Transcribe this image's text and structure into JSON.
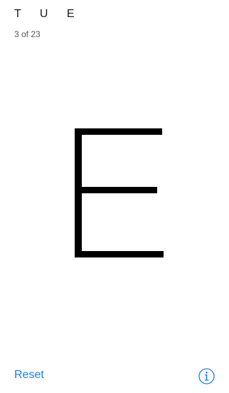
{
  "header": {
    "sequence": "T U E",
    "progress": "3 of 23"
  },
  "card": {
    "letter": "E"
  },
  "footer": {
    "reset_label": "Reset",
    "info_icon": "info-icon"
  },
  "colors": {
    "accent": "#1a7cf5",
    "text": "#1c1c1c",
    "subtext": "#555555",
    "background": "#ffffff"
  }
}
